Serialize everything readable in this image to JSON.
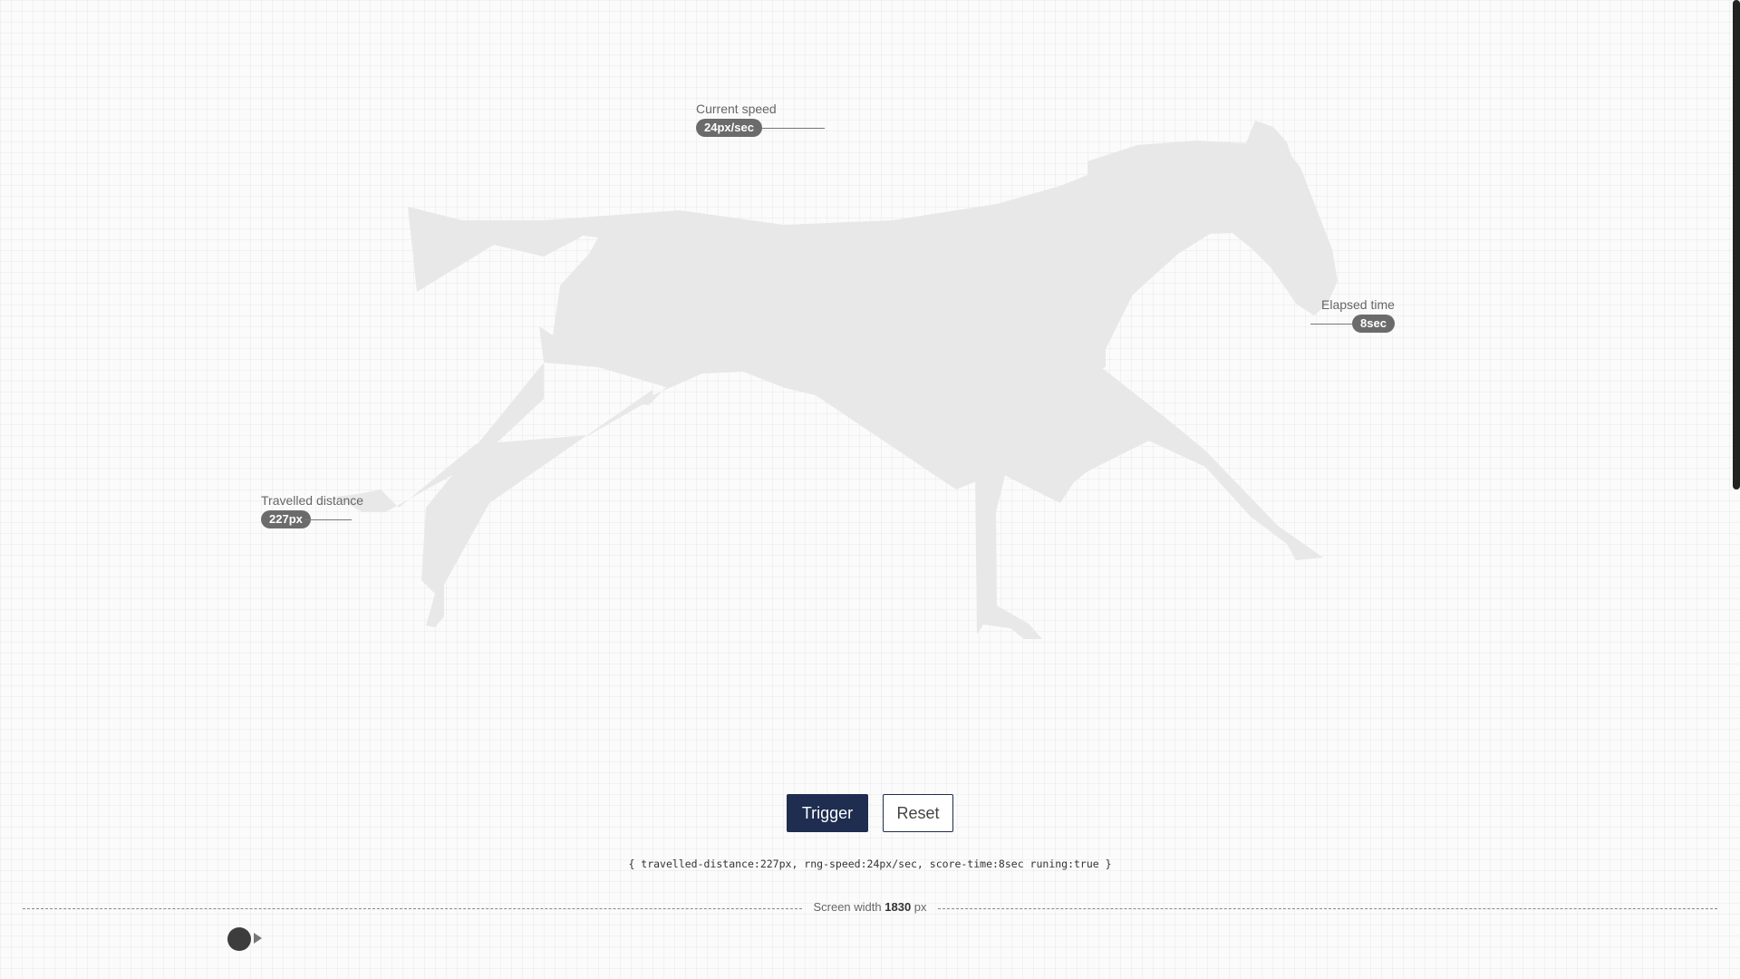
{
  "metrics": {
    "speed": {
      "label": "Current speed",
      "value": "24px/sec"
    },
    "elapsed": {
      "label": "Elapsed time",
      "value": "8sec"
    },
    "distance": {
      "label": "Travelled distance",
      "value": "227px"
    }
  },
  "controls": {
    "trigger_label": "Trigger",
    "reset_label": "Reset"
  },
  "status_text": "{ travelled-distance:227px, rng-speed:24px/sec, score-time:8sec runing:true }",
  "ruler": {
    "prefix": "Screen width",
    "value": "1830",
    "unit": "px"
  },
  "icons": {
    "horse": "horse-silhouette",
    "slider_handle": "slider-handle-icon",
    "play": "play-arrow-icon"
  },
  "colors": {
    "primary": "#1e2d50",
    "horse_fill": "#e8e8e8",
    "pill_bg": "#6b6b6b",
    "background": "#fbfbfb"
  }
}
